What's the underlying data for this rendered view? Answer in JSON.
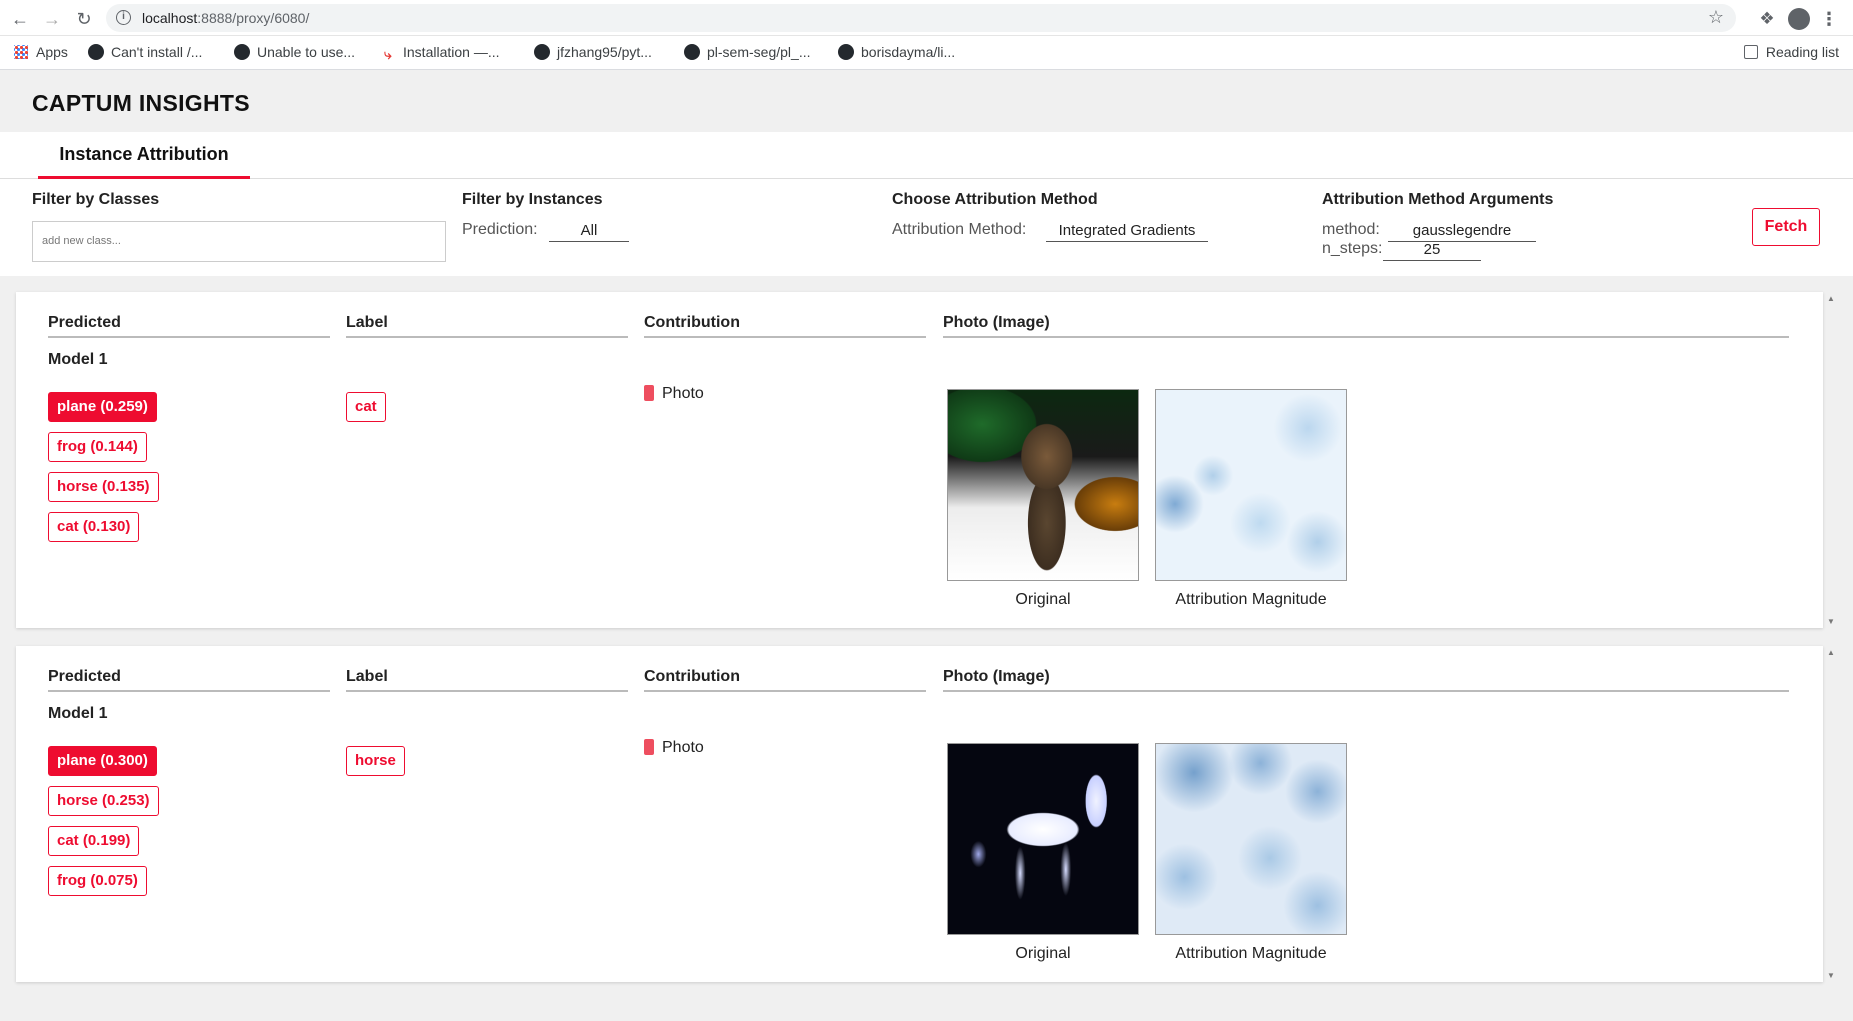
{
  "browser": {
    "url_host": "localhost",
    "url_rest": ":8888/proxy/6080/",
    "bookmarks": [
      {
        "label": "Apps",
        "icon": "apps-grid-icon"
      },
      {
        "label": "Can't install /...",
        "icon": "github-icon"
      },
      {
        "label": "Unable to use...",
        "icon": "github-icon"
      },
      {
        "label": "Installation —...",
        "icon": "installation-icon"
      },
      {
        "label": "jfzhang95/pyt...",
        "icon": "github-icon"
      },
      {
        "label": "pl-sem-seg/pl_...",
        "icon": "github-icon"
      },
      {
        "label": "borisdayma/li...",
        "icon": "github-icon"
      }
    ],
    "reading_list": "Reading list"
  },
  "app": {
    "title": "CAPTUM INSIGHTS",
    "tab": "Instance Attribution",
    "accent_color": "#ee0c30"
  },
  "filters": {
    "classes": {
      "title": "Filter by Classes",
      "placeholder": "add new class..."
    },
    "instances": {
      "title": "Filter by Instances",
      "label": "Prediction:",
      "value": "All"
    },
    "method": {
      "title": "Choose Attribution Method",
      "label": "Attribution Method:",
      "value": "Integrated Gradients"
    },
    "arguments": {
      "title": "Attribution Method Arguments",
      "method_label": "method:",
      "method_value": "gausslegendre",
      "steps_label": "n_steps:",
      "steps_value": "25"
    },
    "fetch": "Fetch"
  },
  "columns": {
    "predicted": "Predicted",
    "label": "Label",
    "contribution": "Contribution",
    "photo": "Photo (Image)"
  },
  "instances": [
    {
      "model": "Model 1",
      "predictions": [
        "plane (0.259)",
        "frog (0.144)",
        "horse (0.135)",
        "cat (0.130)"
      ],
      "label": "cat",
      "contribution": "Photo",
      "captions": [
        "Original",
        "Attribution Magnitude"
      ]
    },
    {
      "model": "Model 1",
      "predictions": [
        "plane (0.300)",
        "horse (0.253)",
        "cat (0.199)",
        "frog (0.075)"
      ],
      "label": "horse",
      "contribution": "Photo",
      "captions": [
        "Original",
        "Attribution Magnitude"
      ]
    }
  ]
}
